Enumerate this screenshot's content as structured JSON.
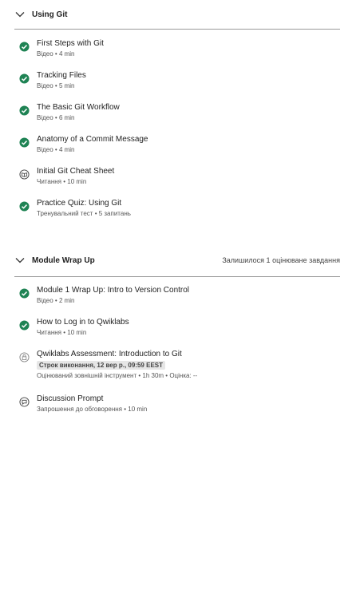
{
  "sections": [
    {
      "title": "Using Git",
      "status": "",
      "items": [
        {
          "title": "First Steps with Git",
          "type": "Відео",
          "duration": "4 min",
          "icon": "completed-check-icon"
        },
        {
          "title": "Tracking Files",
          "type": "Відео",
          "duration": "5 min",
          "icon": "completed-check-icon"
        },
        {
          "title": "The Basic Git Workflow",
          "type": "Відео",
          "duration": "6 min",
          "icon": "completed-check-icon"
        },
        {
          "title": "Anatomy of a Commit Message",
          "type": "Відео",
          "duration": "4 min",
          "icon": "completed-check-icon"
        },
        {
          "title": "Initial Git Cheat Sheet",
          "type": "Читання",
          "duration": "10 min",
          "icon": "reading-icon"
        },
        {
          "title": "Practice Quiz: Using Git",
          "type": "Тренувальний тест",
          "duration": "5 запитань",
          "icon": "completed-check-icon"
        }
      ]
    },
    {
      "title": "Module Wrap Up",
      "status": "Залишилося 1 оцінюване завдання",
      "items": [
        {
          "title": "Module 1 Wrap Up: Intro to Version Control",
          "type": "Відео",
          "duration": "2 min",
          "icon": "completed-check-icon"
        },
        {
          "title": "How to Log in to Qwiklabs",
          "type": "Читання",
          "duration": "10 min",
          "icon": "completed-check-icon"
        },
        {
          "title": "Qwiklabs Assessment: Introduction to Git",
          "due": "Строк виконання, 12 вер р., 09:59 EEST",
          "type": "Оцінюваний зовнішній інструмент",
          "duration": "1h 30m",
          "grade": "Оцінка: --",
          "icon": "locked-lab-icon"
        },
        {
          "title": "Discussion Prompt",
          "type": "Запрошення до обговорення",
          "duration": "10 min",
          "icon": "discussion-icon"
        }
      ]
    }
  ],
  "colors": {
    "check_green": "#1f8354",
    "text_primary": "#1f1f1f",
    "text_secondary": "#555555",
    "divider": "#9a9a9a",
    "badge_bg": "#e6e6e6"
  }
}
